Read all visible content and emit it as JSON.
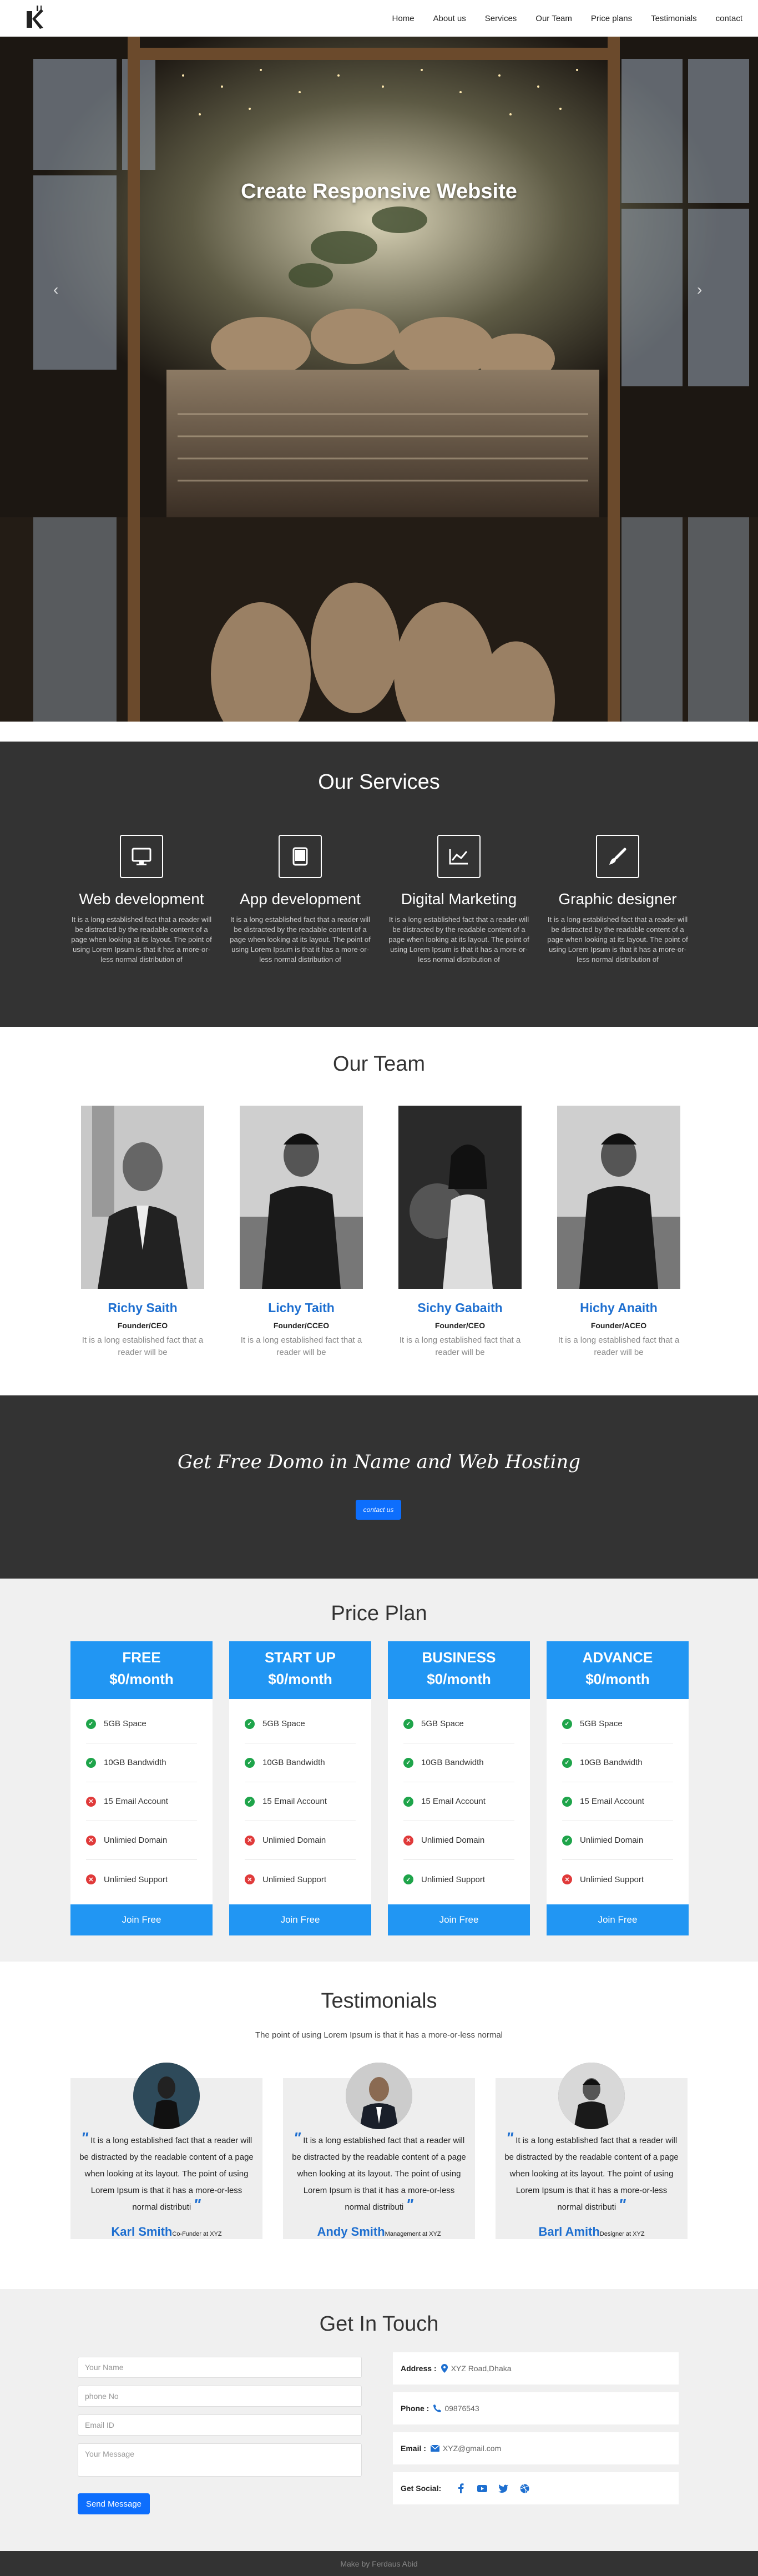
{
  "nav": {
    "items": [
      "Home",
      "About us",
      "Services",
      "Our Team",
      "Price plans",
      "Testimonials",
      "contact"
    ]
  },
  "hero": {
    "title": "Create Responsive Website"
  },
  "services": {
    "title": "Our Services",
    "items": [
      {
        "icon": "monitor-icon",
        "title": "Web development",
        "text": "It is a long established fact that a reader will be distracted by the readable content of a page when looking at its layout. The point of using Lorem Ipsum is that it has a more-or-less normal distribution of"
      },
      {
        "icon": "tablet-icon",
        "title": "App development",
        "text": "It is a long established fact that a reader will be distracted by the readable content of a page when looking at its layout. The point of using Lorem Ipsum is that it has a more-or-less normal distribution of"
      },
      {
        "icon": "chart-icon",
        "title": "Digital Marketing",
        "text": "It is a long established fact that a reader will be distracted by the readable content of a page when looking at its layout. The point of using Lorem Ipsum is that it has a more-or-less normal distribution of"
      },
      {
        "icon": "paintbrush-icon",
        "title": "Graphic designer",
        "text": "It is a long established fact that a reader will be distracted by the readable content of a page when looking at its layout. The point of using Lorem Ipsum is that it has a more-or-less normal distribution of"
      }
    ]
  },
  "team": {
    "title": "Our Team",
    "members": [
      {
        "name": "Richy Saith",
        "role": "Founder/CEO",
        "text": "It is a long established fact that a reader will be"
      },
      {
        "name": "Lichy Taith",
        "role": "Founder/CCEO",
        "text": "It is a long established fact that a reader will be"
      },
      {
        "name": "Sichy Gabaith",
        "role": "Founder/CEO",
        "text": "It is a long established fact that a reader will be"
      },
      {
        "name": "Hichy Anaith",
        "role": "Founder/ACEO",
        "text": "It is a long established fact that a reader will be"
      }
    ]
  },
  "promo": {
    "title": "Get Free Domo in Name and Web Hosting",
    "button": "contact us"
  },
  "price": {
    "title": "Price Plan",
    "features": [
      "5GB Space",
      "10GB Bandwidth",
      "15 Email Account",
      "Unlimied Domain",
      "Unlimied Support"
    ],
    "plans": [
      {
        "name": "FREE",
        "price": "$0/month",
        "checks": [
          true,
          true,
          false,
          false,
          false
        ],
        "button": "Join Free"
      },
      {
        "name": "START UP",
        "price": "$0/month",
        "checks": [
          true,
          true,
          true,
          false,
          false
        ],
        "button": "Join Free"
      },
      {
        "name": "BUSINESS",
        "price": "$0/month",
        "checks": [
          true,
          true,
          true,
          false,
          true
        ],
        "button": "Join Free"
      },
      {
        "name": "ADVANCE",
        "price": "$0/month",
        "checks": [
          true,
          true,
          true,
          true,
          false
        ],
        "button": "Join Free"
      }
    ]
  },
  "testimonials": {
    "title": "Testimonials",
    "subtitle": "The point of using Lorem Ipsum is that it has a more-or-less normal",
    "items": [
      {
        "text": "It is a long established fact that a reader will be distracted by the readable content of a page when looking at its layout. The point of using Lorem Ipsum is that it has a more-or-less normal distributi",
        "name": "Karl Smith",
        "role": "Co-Funder at XYZ"
      },
      {
        "text": "It is a long established fact that a reader will be distracted by the readable content of a page when looking at its layout. The point of using Lorem Ipsum is that it has a more-or-less normal distributi",
        "name": "Andy Smith",
        "role": "Management at XYZ"
      },
      {
        "text": "It is a long established fact that a reader will be distracted by the readable content of a page when looking at its layout. The point of using Lorem Ipsum is that it has a more-or-less normal distributi",
        "name": "Barl Amith",
        "role": "Designer at XYZ"
      }
    ]
  },
  "contact": {
    "title": "Get In Touch",
    "name_placeholder": "Your Name",
    "phone_placeholder": "phone No",
    "email_placeholder": "Email ID",
    "message_placeholder": "Your Message",
    "send": "Send Message",
    "address_label": "Address :",
    "address": "XYZ Road,Dhaka",
    "phone_label": "Phone :",
    "phone": "09876543",
    "email_label": "Email :",
    "email": "XYZ@gmail.com",
    "social_label": "Get Social:"
  },
  "footer": {
    "text": "Make by Ferdaus Abid"
  }
}
